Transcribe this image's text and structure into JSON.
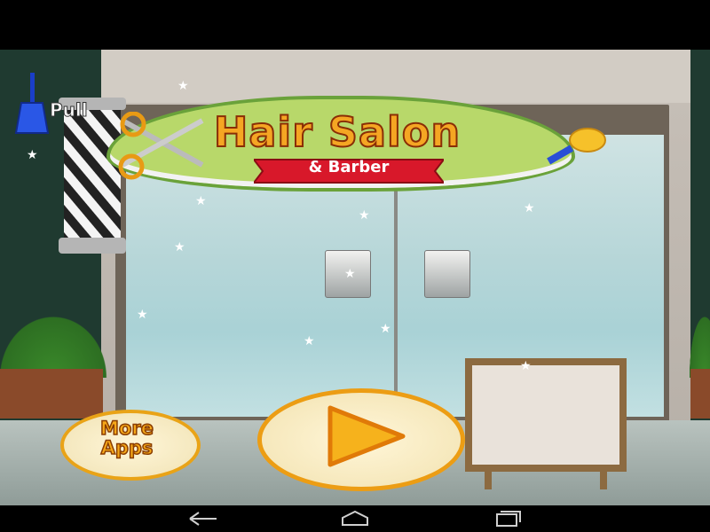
{
  "game": {
    "title": "Hair Salon",
    "subtitle": "& Barber",
    "pull_label": "Pull",
    "more_apps_label": "More\nApps"
  },
  "icons": {
    "pull_handle": "blue-bell-handle-icon",
    "scissors": "scissors-icon",
    "brush": "brush-icon",
    "play": "play-triangle-icon",
    "nav_back": "back-arrow-icon",
    "nav_home": "home-icon",
    "nav_recents": "recent-apps-icon"
  },
  "colors": {
    "title_fill": "#f5a623",
    "title_outline": "#8a2e06",
    "ribbon": "#d8182a",
    "sign_green": "#b8d86a",
    "button_border": "#ec9d14",
    "play_triangle": "#f6b21c"
  }
}
